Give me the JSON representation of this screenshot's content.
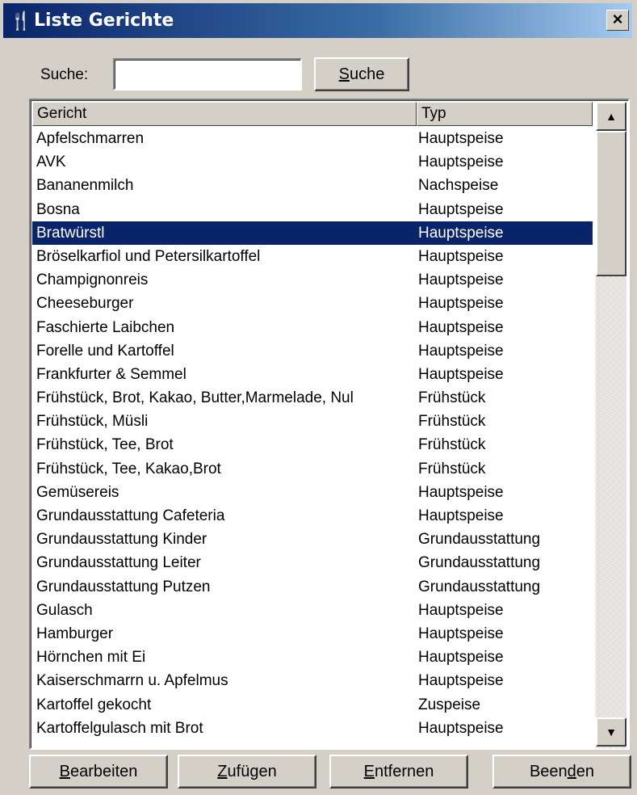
{
  "window": {
    "title": "Liste Gerichte",
    "icon": "cutlery-icon",
    "close_label": "×"
  },
  "search": {
    "label": "Suche:",
    "value": "",
    "placeholder": "",
    "button_accel": "S",
    "button_rest": "uche"
  },
  "table": {
    "columns": [
      "Gericht",
      "Typ"
    ],
    "rows": [
      [
        "Apfelschmarren",
        "Hauptspeise"
      ],
      [
        "AVK",
        "Hauptspeise"
      ],
      [
        "Bananenmilch",
        "Nachspeise"
      ],
      [
        "Bosna",
        "Hauptspeise"
      ],
      [
        "Bratwürstl",
        "Hauptspeise"
      ],
      [
        "Bröselkarfiol und Petersilkartoffel",
        "Hauptspeise"
      ],
      [
        "Champignonreis",
        "Hauptspeise"
      ],
      [
        "Cheeseburger",
        "Hauptspeise"
      ],
      [
        "Faschierte Laibchen",
        "Hauptspeise"
      ],
      [
        "Forelle und Kartoffel",
        "Hauptspeise"
      ],
      [
        "Frankfurter & Semmel",
        "Hauptspeise"
      ],
      [
        "Frühstück, Brot, Kakao, Butter,Marmelade, Nul",
        "Frühstück"
      ],
      [
        "Frühstück, Müsli",
        "Frühstück"
      ],
      [
        "Frühstück, Tee, Brot",
        "Frühstück"
      ],
      [
        "Frühstück, Tee, Kakao,Brot",
        "Frühstück"
      ],
      [
        "Gemüsereis",
        "Hauptspeise"
      ],
      [
        "Grundausstattung Cafeteria",
        "Hauptspeise"
      ],
      [
        "Grundausstattung Kinder",
        "Grundausstattung"
      ],
      [
        "Grundausstattung Leiter",
        "Grundausstattung"
      ],
      [
        "Grundausstattung Putzen",
        "Grundausstattung"
      ],
      [
        "Gulasch",
        "Hauptspeise"
      ],
      [
        "Hamburger",
        "Hauptspeise"
      ],
      [
        "Hörnchen mit Ei",
        "Hauptspeise"
      ],
      [
        "Kaiserschmarrn u.  Apfelmus",
        "Hauptspeise"
      ],
      [
        "Kartoffel gekocht",
        "Zuspeise"
      ],
      [
        "Kartoffelgulasch mit Brot",
        "Hauptspeise"
      ]
    ],
    "selected_index": 4
  },
  "scrollbar": {
    "up_icon": "▲",
    "down_icon": "▼"
  },
  "buttons": {
    "edit": {
      "accel": "B",
      "rest": "earbeiten"
    },
    "add": {
      "accel": "Z",
      "rest": "ufügen"
    },
    "remove": {
      "accel": "E",
      "rest": "ntfernen"
    },
    "quit": {
      "pre": "Been",
      "accel": "d",
      "rest": "en"
    }
  }
}
